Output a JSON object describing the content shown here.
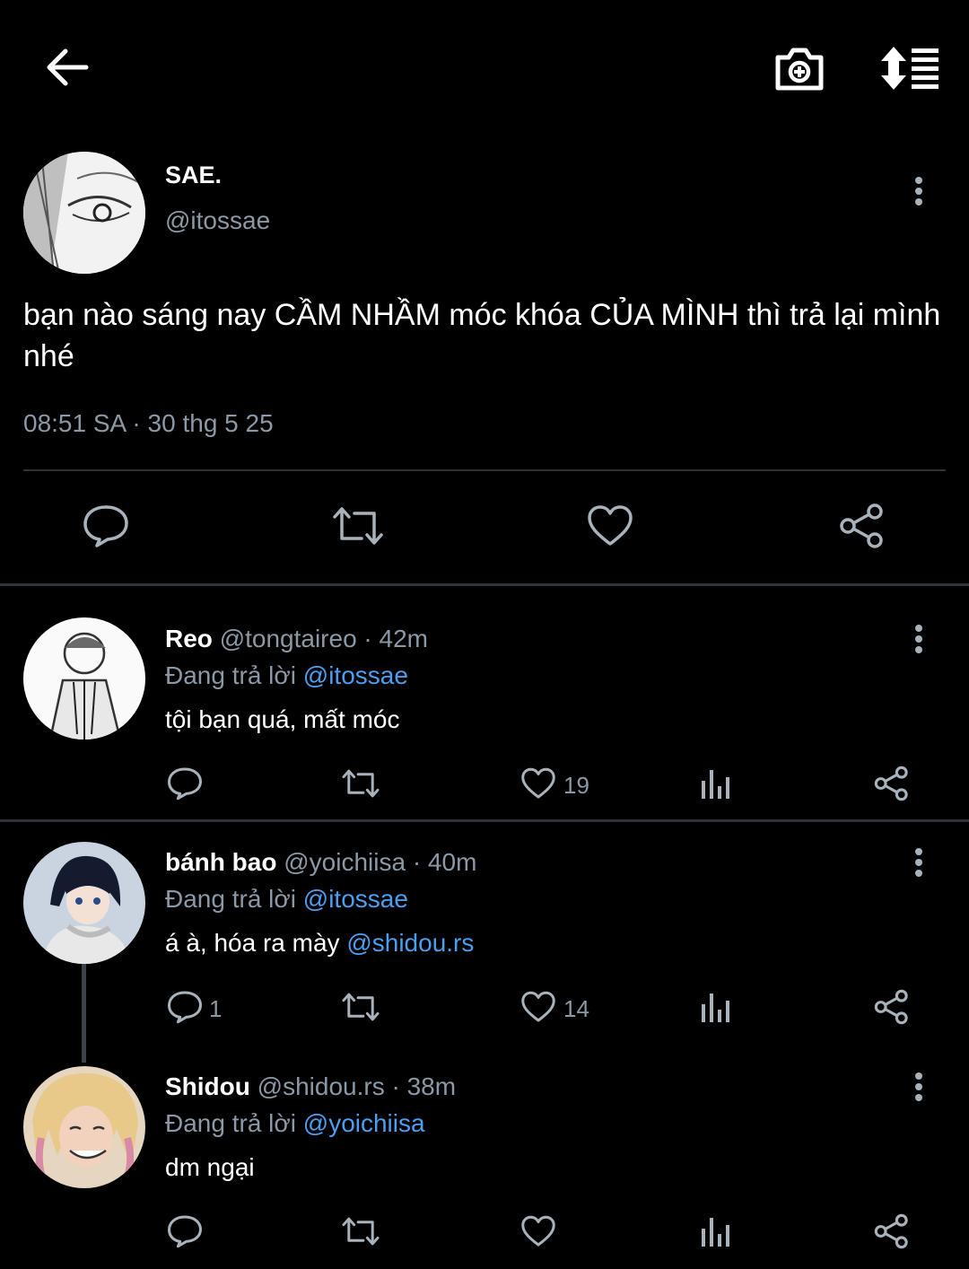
{
  "header": {
    "back_icon": "arrow-left-icon",
    "camera_icon": "camera-add-icon",
    "sort_icon": "sort-list-icon"
  },
  "tweet": {
    "name": "SAE.",
    "handle": "@itossae",
    "text": "bạn nào sáng nay CẦM NHẦM móc khóa CỦA MÌNH thì trả lại mình nhé",
    "timestamp": "08:51 SA · 30 thg 5 25",
    "actions": [
      "reply-icon",
      "retweet-icon",
      "heart-icon",
      "share-icon"
    ]
  },
  "replies": [
    {
      "name": "Reo",
      "handle_time": "@tongtaireo · 42m",
      "replying_prefix": "Đang trả lời",
      "replying_to": "@itossae",
      "text": "tội bạn quá, mất móc",
      "mention": "",
      "reply_count": "",
      "like_count": "19"
    },
    {
      "name": "bánh bao",
      "handle_time": "@yoichiisa · 40m",
      "replying_prefix": "Đang trả lời",
      "replying_to": "@itossae",
      "text": "á à, hóa ra mày ",
      "mention": "@shidou.rs",
      "reply_count": "1",
      "like_count": "14"
    },
    {
      "name": "Shidou",
      "handle_time": "@shidou.rs · 38m",
      "replying_prefix": "Đang trả lời",
      "replying_to": "@yoichiisa",
      "text": "dm ngại",
      "mention": "",
      "reply_count": "",
      "like_count": ""
    }
  ],
  "colors": {
    "background": "#000000",
    "text": "#ffffff",
    "muted": "#8b98a5",
    "link": "#4c9ff0",
    "divider": "#2f3336"
  }
}
